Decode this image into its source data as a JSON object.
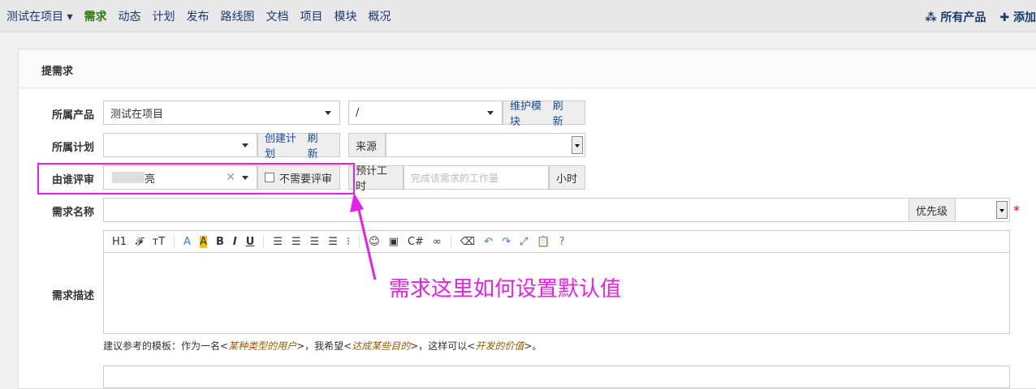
{
  "nav": {
    "product": "测试在项目",
    "items": [
      "需求",
      "动态",
      "计划",
      "发布",
      "路线图",
      "文档",
      "项目",
      "模块",
      "概况"
    ],
    "active": "需求",
    "all_products": "所有产品",
    "add": "添加"
  },
  "panel": {
    "title": "提需求"
  },
  "form": {
    "product": {
      "label": "所属产品",
      "value": "测试在项目",
      "module_value": "/",
      "maintain_module": "维护模块",
      "refresh": "刷新"
    },
    "plan": {
      "label": "所属计划",
      "value": "",
      "create_plan": "创建计划",
      "refresh": "刷新",
      "source_label": "来源",
      "source_value": ""
    },
    "reviewer": {
      "label": "由谁评审",
      "value": "亮",
      "no_review": "不需要评审",
      "estimate_label": "预计工时",
      "estimate_placeholder": "完成该需求的工作量",
      "hours": "小时"
    },
    "title": {
      "label": "需求名称",
      "priority_label": "优先级",
      "required_mark": "*"
    },
    "desc": {
      "label": "需求描述",
      "hint_prefix": "建议参考的模板：作为一名<",
      "hint_a": "某种类型的用户",
      "hint_mid1": ">，我希望<",
      "hint_b": "达成某些目的",
      "hint_mid2": ">，这样可以<",
      "hint_c": "开发的价值",
      "hint_end": ">。"
    }
  },
  "toolbar": {
    "items": [
      "H1",
      "𝓕",
      "тT",
      "A",
      "A",
      "B",
      "I",
      "U"
    ]
  },
  "annotation": {
    "text": "需求这里如何设置默认值",
    "color": "#e81fe8"
  }
}
